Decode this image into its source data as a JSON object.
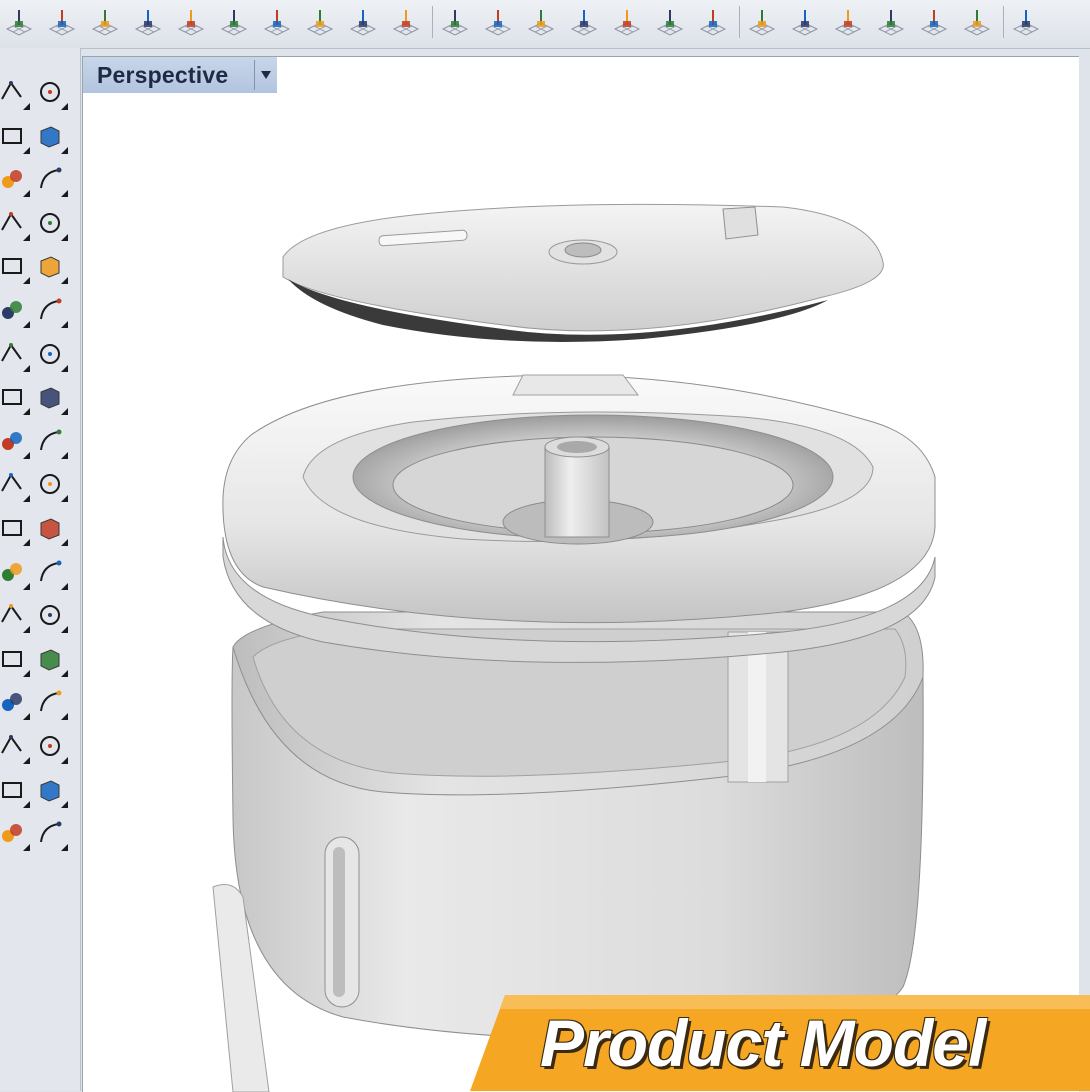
{
  "viewport": {
    "title": "Perspective",
    "menu_icon": "triangle-down-icon"
  },
  "toolbar": {
    "icons": [
      "point-on-grid-icon",
      "move-gumball-icon",
      "box-solid-icon",
      "sphere-render-icon",
      "grid-snap-icon",
      "rotate-grid-icon",
      "axis-grid-icon",
      "point-grid-icon",
      "distance-grid-icon",
      "elevation-grid-icon",
      "undo-view-icon",
      "select-cursor-icon",
      "grid-plane-icon",
      "save-disk-icon",
      "open-folder-icon",
      "print-grid-icon",
      "camera-target-icon",
      "arrow-down-grid-icon",
      "arrow-up-grid-icon",
      "arrow-left-grid-icon",
      "arrow-right-grid-icon",
      "arrow-left-right-icon",
      "arrow-double-icon",
      "view-cube-icon"
    ]
  },
  "leftbar": {
    "icons": [
      "select-arrow-icon",
      "point-icon",
      "polyline-icon",
      "curve-icon",
      "circle-icon",
      "ellipse-icon",
      "arc-icon",
      "rectangle-icon",
      "polygon-icon",
      "fillet-curve-icon",
      "surface-corner-icon",
      "surface-patch-icon",
      "box-icon",
      "boolean-union-icon",
      "extrude-icon",
      "surface-icon",
      "gear-icon",
      "explode-icon",
      "trim-icon",
      "split-icon",
      "mesh-icon",
      "points-cloud-icon",
      "rotate-icon",
      "dimension-icon",
      "text-icon",
      "scale-icon",
      "group-icon",
      "transform-icon",
      "solid-tools-icon",
      "array-icon",
      "grid-array-icon",
      "alignment-icon",
      "analyze-icon",
      "check-icon",
      "render-icon",
      "pyramid-icon"
    ]
  },
  "banner": {
    "text": "Product Model",
    "color": "#f5a623"
  }
}
